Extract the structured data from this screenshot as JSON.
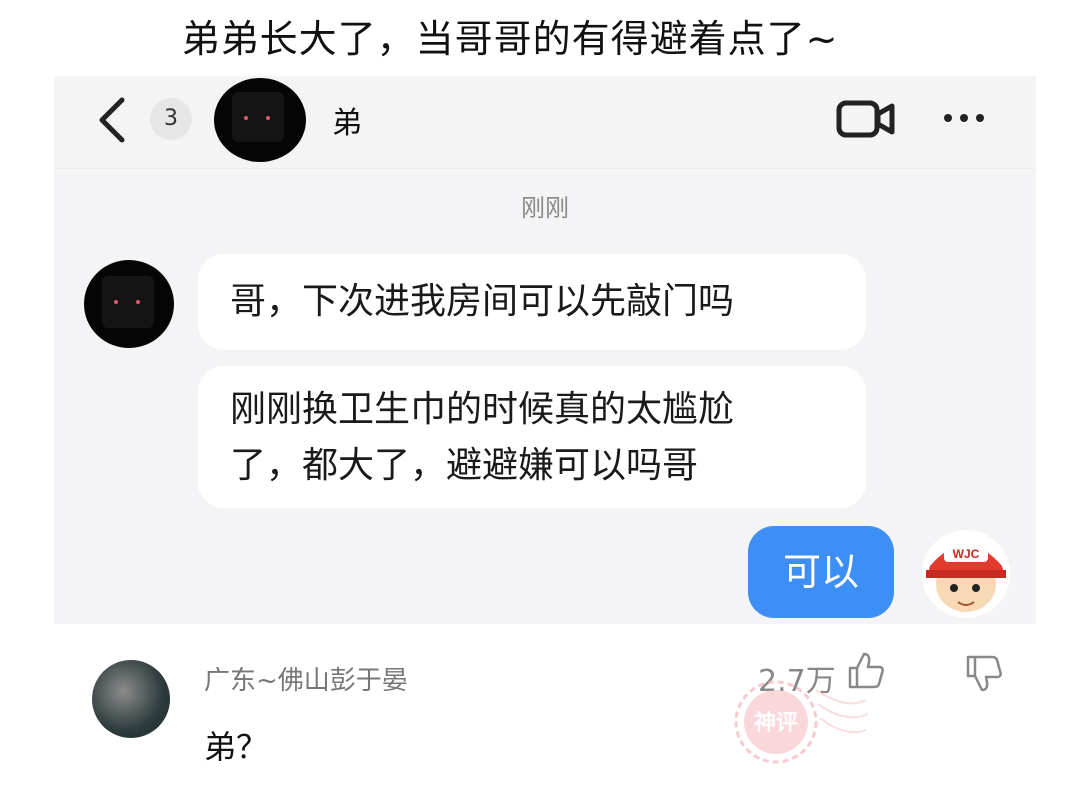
{
  "caption": "弟弟长大了，当哥哥的有得避着点了~",
  "chat": {
    "unread_count": "3",
    "contact_name": "弟",
    "timestamp": "刚刚",
    "messages": [
      {
        "from": "contact",
        "text": "哥，下次进我房间可以先敲门吗"
      },
      {
        "from": "contact",
        "text": "刚刚换卫生巾的时候真的太尴尬\n了，都大了，避避嫌可以吗哥"
      },
      {
        "from": "me",
        "text": "可以"
      }
    ],
    "my_avatar_badge": "WJC",
    "outgoing_color": "#3d8ef5"
  },
  "comment": {
    "user": "广东~佛山彭于晏",
    "likes": "2.7万",
    "text": "弟？"
  },
  "watermark_text": "神评"
}
